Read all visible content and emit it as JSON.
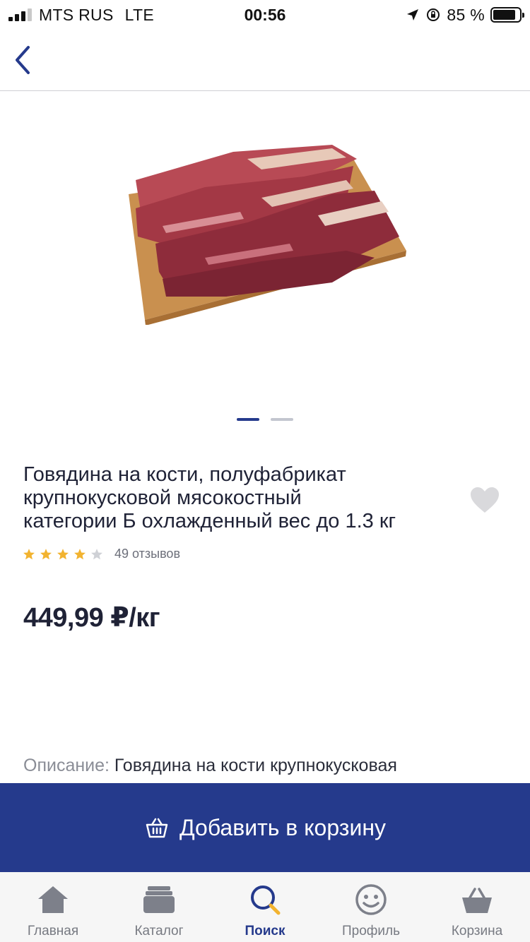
{
  "status_bar": {
    "carrier": "MTS RUS",
    "network": "LTE",
    "time": "00:56",
    "battery": "85 %",
    "battery_level": 0.85
  },
  "nav": {
    "back_icon": "chevron-left-icon"
  },
  "gallery": {
    "total": 2,
    "active_index": 0
  },
  "product": {
    "title": "Говядина на кости, полуфабрикат\nкрупнокусковой  мясокостный\nкатегории Б охлажденный вес до 1.3 кг",
    "rating": 4,
    "rating_max": 5,
    "reviews": "49 отзывов",
    "price": "449,99 ₽/кг",
    "description_label": "Описание:",
    "description_text": " Говядина на кости крупнокусковая"
  },
  "actions": {
    "add_to_cart": "Добавить в корзину"
  },
  "tabbar": {
    "tabs": [
      {
        "label": "Главная",
        "icon": "home-icon"
      },
      {
        "label": "Каталог",
        "icon": "catalog-icon"
      },
      {
        "label": "Поиск",
        "icon": "search-icon",
        "active": true
      },
      {
        "label": "Профиль",
        "icon": "profile-icon"
      },
      {
        "label": "Корзина",
        "icon": "basket-icon"
      }
    ]
  },
  "colors": {
    "brand": "#253a8c",
    "star_filled": "#f2b330",
    "star_empty": "#cfd1d6",
    "text": "#1f2236",
    "muted": "#777a82"
  }
}
